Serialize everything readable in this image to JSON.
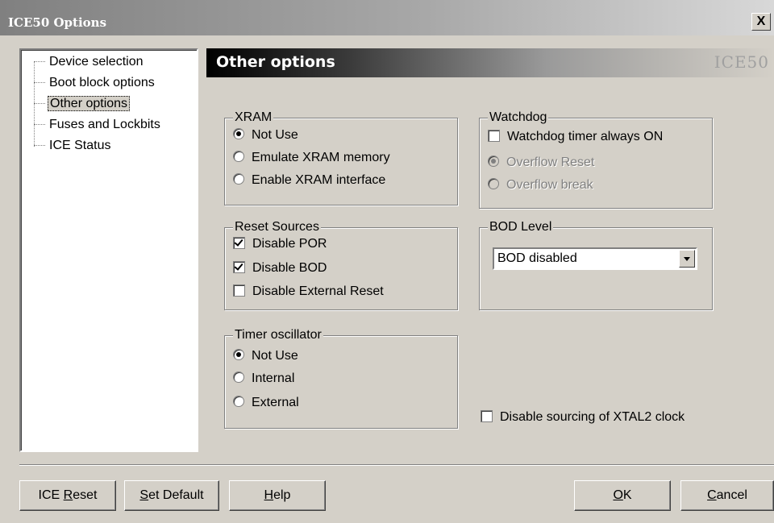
{
  "window": {
    "title": "ICE50 Options",
    "close_glyph": "X"
  },
  "tree": {
    "items": [
      {
        "label": "Device selection",
        "selected": false
      },
      {
        "label": "Boot block options",
        "selected": false
      },
      {
        "label": "Other options",
        "selected": true
      },
      {
        "label": "Fuses and Lockbits",
        "selected": false
      },
      {
        "label": "ICE Status",
        "selected": false
      }
    ]
  },
  "header": {
    "title": "Other options",
    "brand": "ICE50"
  },
  "xram": {
    "legend": "XRAM",
    "options": [
      {
        "label": "Not Use",
        "selected": true
      },
      {
        "label": "Emulate XRAM memory",
        "selected": false
      },
      {
        "label": "Enable XRAM interface",
        "selected": false
      }
    ]
  },
  "watchdog": {
    "legend": "Watchdog",
    "always_on": {
      "label": "Watchdog timer always ON",
      "checked": false
    },
    "options": [
      {
        "label": "Overflow Reset",
        "selected": true,
        "enabled": false
      },
      {
        "label": "Overflow break",
        "selected": false,
        "enabled": false
      }
    ]
  },
  "reset_sources": {
    "legend": "Reset Sources",
    "items": [
      {
        "label": "Disable POR",
        "checked": true
      },
      {
        "label": "Disable BOD",
        "checked": true
      },
      {
        "label": "Disable External Reset",
        "checked": false
      }
    ]
  },
  "bod": {
    "legend": "BOD Level",
    "value": "BOD disabled"
  },
  "timer_osc": {
    "legend": "Timer oscillator",
    "options": [
      {
        "label": "Not Use",
        "selected": true
      },
      {
        "label": "Internal",
        "selected": false
      },
      {
        "label": "External",
        "selected": false
      }
    ]
  },
  "xtal2": {
    "label": "Disable sourcing of XTAL2 clock",
    "checked": false
  },
  "buttons": {
    "ice_reset": {
      "pre": "ICE ",
      "key": "R",
      "post": "eset"
    },
    "set_default": {
      "pre": "",
      "key": "S",
      "post": "et Default"
    },
    "help": {
      "pre": "",
      "key": "H",
      "post": "elp"
    },
    "ok": {
      "pre": "",
      "key": "O",
      "post": "K"
    },
    "cancel": {
      "pre": "",
      "key": "C",
      "post": "ancel"
    }
  }
}
